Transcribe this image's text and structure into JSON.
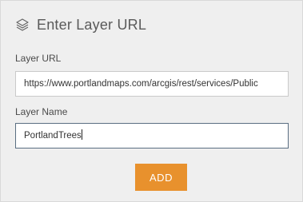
{
  "header": {
    "icon": "layers-icon",
    "title": "Enter Layer URL"
  },
  "form": {
    "layer_url": {
      "label": "Layer URL",
      "value": "https://www.portlandmaps.com/arcgis/rest/services/Public"
    },
    "layer_name": {
      "label": "Layer Name",
      "value": "PortlandTrees"
    },
    "add_label": "ADD"
  },
  "colors": {
    "panel_bg": "#efefef",
    "button_accent": "#e8912d",
    "focused_border": "#5a6e82"
  }
}
